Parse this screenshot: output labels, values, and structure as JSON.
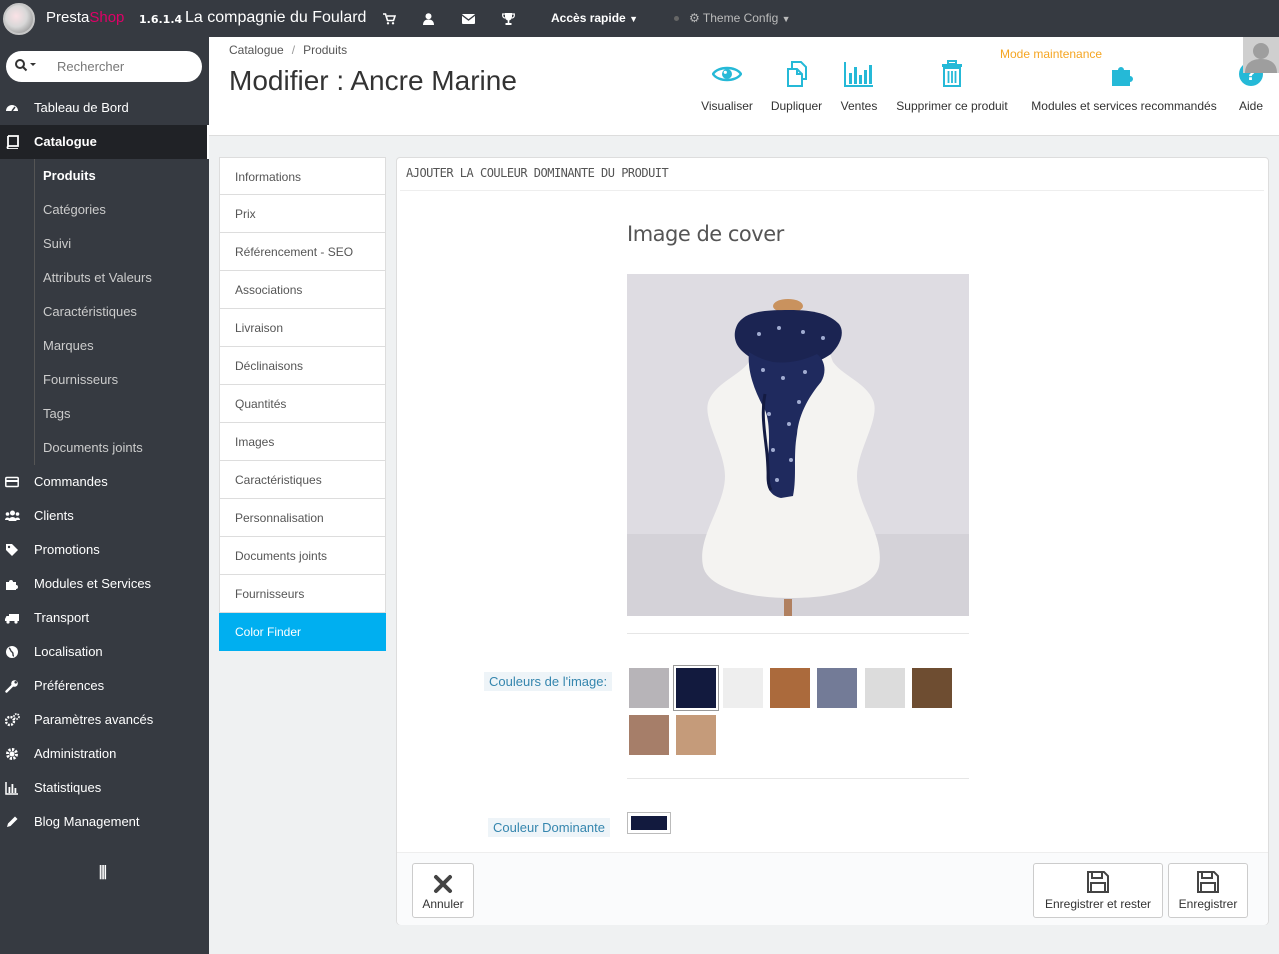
{
  "topbar": {
    "brand_presta": "Presta",
    "brand_shop": "Shop",
    "version": "1.6.1.4",
    "shop_name": "La compagnie du Foulard",
    "icons": [
      "cart-icon",
      "user-icon",
      "envelope-icon",
      "trophy-icon"
    ],
    "quick_access": "Accès rapide",
    "theme_config": "Theme Config"
  },
  "sidebar": {
    "search_placeholder": "Rechercher",
    "items": [
      {
        "label": "Tableau de Bord",
        "icon": "dashboard-icon"
      },
      {
        "label": "Catalogue",
        "icon": "book-icon"
      },
      {
        "label": "Commandes",
        "icon": "credit-card-icon"
      },
      {
        "label": "Clients",
        "icon": "users-icon"
      },
      {
        "label": "Promotions",
        "icon": "tag-icon"
      },
      {
        "label": "Modules et Services",
        "icon": "puzzle-icon"
      },
      {
        "label": "Transport",
        "icon": "truck-icon"
      },
      {
        "label": "Localisation",
        "icon": "globe-icon"
      },
      {
        "label": "Préférences",
        "icon": "wrench-icon"
      },
      {
        "label": "Paramètres avancés",
        "icon": "cogs-icon"
      },
      {
        "label": "Administration",
        "icon": "cog-icon"
      },
      {
        "label": "Statistiques",
        "icon": "bar-chart-icon"
      },
      {
        "label": "Blog Management",
        "icon": "pencil-icon"
      }
    ],
    "catalogue_sub": [
      "Produits",
      "Catégories",
      "Suivi",
      "Attributs et Valeurs",
      "Caractéristiques",
      "Marques",
      "Fournisseurs",
      "Tags",
      "Documents joints"
    ]
  },
  "header": {
    "breadcrumb": [
      "Catalogue",
      "Produits"
    ],
    "title": "Modifier : Ancre Marine",
    "maintenance": "Mode maintenance",
    "toolbar": {
      "view": "Visualiser",
      "duplicate": "Dupliquer",
      "sales": "Ventes",
      "delete": "Supprimer ce produit",
      "modules": "Modules et services recommandés",
      "help": "Aide"
    }
  },
  "tabs": [
    "Informations",
    "Prix",
    "Référencement - SEO",
    "Associations",
    "Livraison",
    "Déclinaisons",
    "Quantités",
    "Images",
    "Caractéristiques",
    "Personnalisation",
    "Documents joints",
    "Fournisseurs",
    "Color Finder"
  ],
  "panel": {
    "heading": "AJOUTER LA COULEUR DOMINANTE DU PRODUIT",
    "cover_title": "Image de cover",
    "colors_label": "Couleurs de l'image:",
    "dominant_label": "Couleur Dominante",
    "colors": [
      "#b7b4b8",
      "#121a3e",
      "#eeeeee",
      "#ab6a3c",
      "#737b97",
      "#dcdcdc",
      "#6e4d31",
      "#a67e69",
      "#c59b7a"
    ],
    "selected_color_index": 1,
    "dominant_color": "#121a3e",
    "footer": {
      "cancel": "Annuler",
      "save_stay": "Enregistrer et rester",
      "save": "Enregistrer"
    }
  },
  "colors": {
    "accent": "#00aff0",
    "sidebar": "#363a41",
    "brand_pink": "#df0067",
    "maintenance": "#f5a623"
  }
}
